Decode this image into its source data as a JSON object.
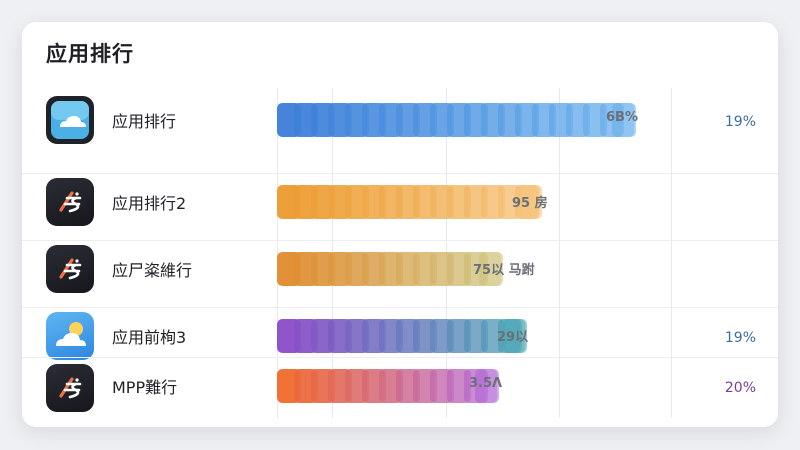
{
  "panel": {
    "title": "应用排行"
  },
  "rows": [
    {
      "name": "应用排行",
      "icon": "weather-cloud-icon",
      "bar_label": "6B%",
      "pct": "19%",
      "progress": 0.92,
      "colors": [
        "#3b7dd8",
        "#6cb2ec"
      ],
      "pct_color": "#3c6e9c"
    },
    {
      "name": "应用排行2",
      "icon": "slash-s-logo-icon",
      "bar_label": "95 房",
      "pct": "",
      "progress": 0.68,
      "colors": [
        "#ec9a2e",
        "#f5c27a"
      ],
      "pct_color": "#a98a5a"
    },
    {
      "name": "应尸粢維行",
      "icon": "slash-s-logo-icon",
      "bar_label": "75以 马跗",
      "pct": "",
      "progress": 0.58,
      "colors": [
        "#e08b2d",
        "#cfc37e"
      ],
      "pct_color": "#a98a5a"
    },
    {
      "name": "应用前栒3",
      "icon": "sky-cloud-icon",
      "bar_label": "29以",
      "pct": "19%",
      "progress": 0.64,
      "colors": [
        "#8a4cc7",
        "#4aa6b4"
      ],
      "pct_color": "#3c6e9c"
    },
    {
      "name": "MPP難行",
      "icon": "slash-s-logo-icon",
      "bar_label": "3.5Λ",
      "pct": "20%",
      "progress": 0.57,
      "colors": [
        "#f0692c",
        "#b469d6"
      ],
      "pct_color": "#7b3c95"
    }
  ]
}
